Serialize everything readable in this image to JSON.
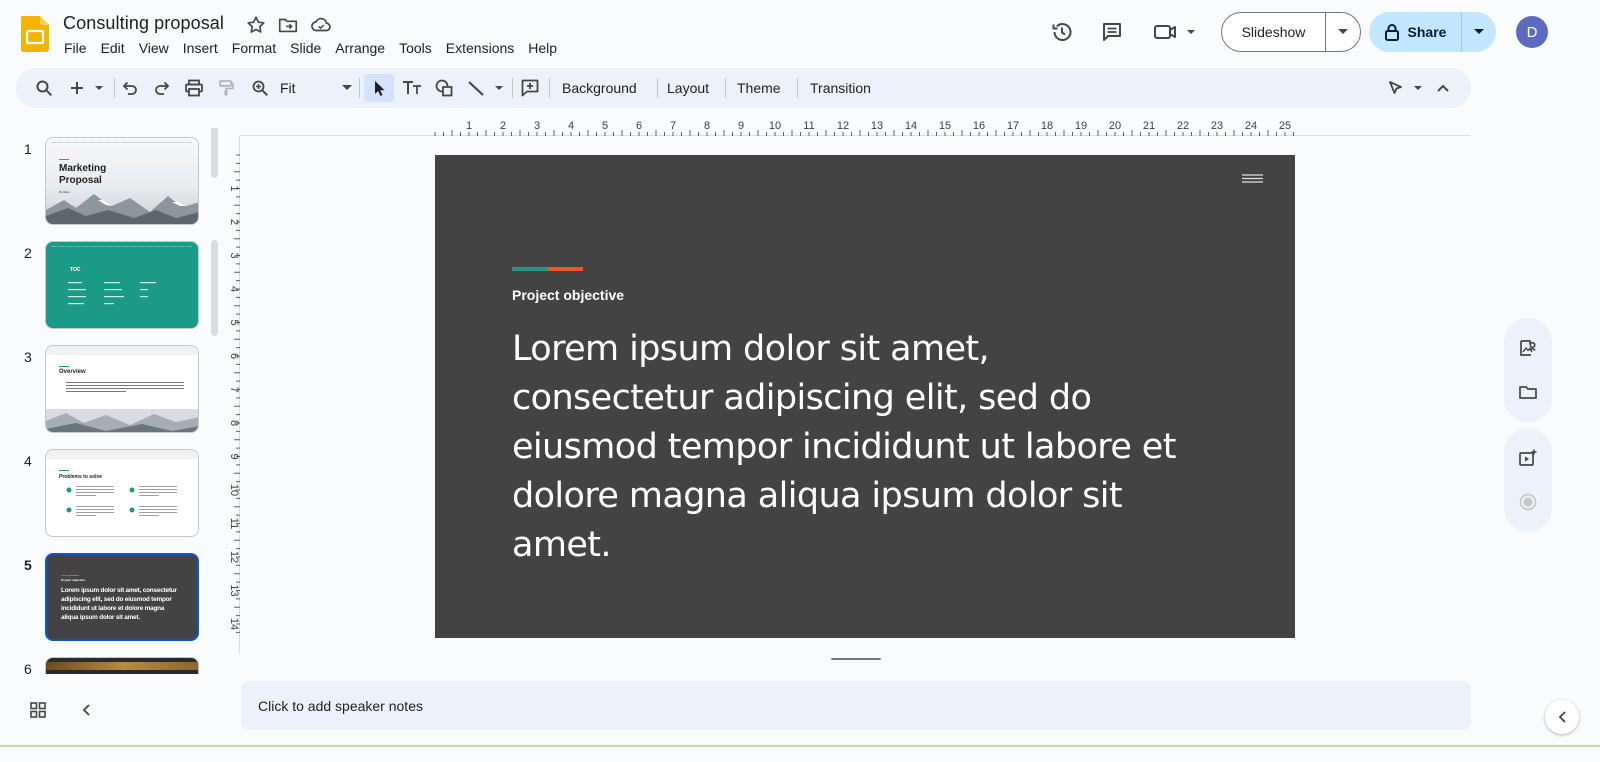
{
  "document": {
    "title": "Consulting proposal"
  },
  "menu": [
    "File",
    "Edit",
    "View",
    "Insert",
    "Format",
    "Slide",
    "Arrange",
    "Tools",
    "Extensions",
    "Help"
  ],
  "header": {
    "slideshow_label": "Slideshow",
    "share_label": "Share",
    "avatar_initial": "D"
  },
  "toolbar": {
    "zoom_value": "Fit",
    "background_label": "Background",
    "layout_label": "Layout",
    "theme_label": "Theme",
    "transition_label": "Transition"
  },
  "filmstrip": {
    "slides": [
      {
        "number": "1",
        "title_line1": "Marketing",
        "title_line2": "Proposal",
        "byline": "By Ellen"
      },
      {
        "number": "2",
        "title": "TOC"
      },
      {
        "number": "3",
        "title": "Overview"
      },
      {
        "number": "4",
        "title": "Problems to solve"
      },
      {
        "number": "5",
        "heading": "Project objective",
        "body": "Lorem ipsum dolor sit amet, consectetur adipiscing elit, sed do eiusmod tempor incididunt ut labore et dolore magna aliqua ipsum dolor sit amet."
      },
      {
        "number": "6"
      }
    ]
  },
  "ruler": {
    "horizontal": [
      "1",
      "2",
      "3",
      "4",
      "5",
      "6",
      "7",
      "8",
      "9",
      "10",
      "11",
      "12",
      "13",
      "14",
      "15",
      "16",
      "17",
      "18",
      "19",
      "20",
      "21",
      "22",
      "23",
      "24",
      "25"
    ],
    "vertical": [
      "1",
      "2",
      "3",
      "4",
      "5",
      "6",
      "7",
      "8",
      "9",
      "10",
      "11",
      "12",
      "13",
      "14"
    ]
  },
  "slide": {
    "heading": "Project objective",
    "body": "Lorem ipsum dolor sit amet, consectetur adipiscing elit, sed do eiusmod tempor incididunt ut labore et dolore magna aliqua ipsum dolor sit amet.",
    "accent_colors": [
      "#1a9a87",
      "#e8582a"
    ],
    "background": "#434343"
  },
  "notes": {
    "placeholder": "Click to add speaker notes"
  },
  "colors": {
    "accent": "#0b57d0",
    "share_bg": "#c2e7ff",
    "toolbar_bg": "#edf2fa",
    "toc_green": "#1a9a87"
  }
}
